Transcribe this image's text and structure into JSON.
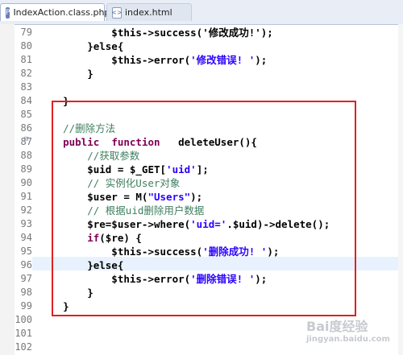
{
  "tabs": [
    {
      "label": "IndexAction.class.php",
      "active": true,
      "close": "☒"
    },
    {
      "label": "index.html",
      "active": false
    }
  ],
  "code_lines": [
    {
      "n": "79",
      "segments": [
        {
          "t": "            $this->success('修改成功!');",
          "c": ""
        }
      ]
    },
    {
      "n": "80",
      "segments": [
        {
          "t": "        }else{",
          "c": ""
        }
      ]
    },
    {
      "n": "81",
      "segments": [
        {
          "t": "            $this->error(",
          "c": ""
        },
        {
          "t": "'修改错误! '",
          "c": "st"
        },
        {
          "t": ");",
          "c": ""
        }
      ]
    },
    {
      "n": "82",
      "segments": [
        {
          "t": "        }",
          "c": ""
        }
      ]
    },
    {
      "n": "83",
      "segments": [
        {
          "t": "",
          "c": ""
        }
      ]
    },
    {
      "n": "84",
      "segments": [
        {
          "t": "    }",
          "c": ""
        }
      ]
    },
    {
      "n": "85",
      "segments": [
        {
          "t": "",
          "c": ""
        }
      ]
    },
    {
      "n": "86",
      "segments": [
        {
          "t": "    ",
          "c": ""
        },
        {
          "t": "//删除方法",
          "c": "cm"
        }
      ]
    },
    {
      "n": "87",
      "segments": [
        {
          "t": "    ",
          "c": ""
        },
        {
          "t": "public",
          "c": "kw"
        },
        {
          "t": "  ",
          "c": ""
        },
        {
          "t": "function",
          "c": "kw"
        },
        {
          "t": "   deleteUser(){",
          "c": ""
        }
      ]
    },
    {
      "n": "88",
      "segments": [
        {
          "t": "        ",
          "c": ""
        },
        {
          "t": "//获取参数",
          "c": "cm"
        }
      ]
    },
    {
      "n": "89",
      "segments": [
        {
          "t": "        $uid = $_GET[",
          "c": ""
        },
        {
          "t": "'uid'",
          "c": "st"
        },
        {
          "t": "];",
          "c": ""
        }
      ]
    },
    {
      "n": "90",
      "segments": [
        {
          "t": "        ",
          "c": ""
        },
        {
          "t": "// 实例化User对象",
          "c": "cm"
        }
      ]
    },
    {
      "n": "91",
      "segments": [
        {
          "t": "        $user = M(",
          "c": ""
        },
        {
          "t": "\"Users\"",
          "c": "st"
        },
        {
          "t": ");",
          "c": ""
        }
      ]
    },
    {
      "n": "92",
      "segments": [
        {
          "t": "        ",
          "c": ""
        },
        {
          "t": "// 根据uid删除用户数据",
          "c": "cm"
        }
      ]
    },
    {
      "n": "93",
      "segments": [
        {
          "t": "        $re=$user->where(",
          "c": ""
        },
        {
          "t": "'uid='",
          "c": "st"
        },
        {
          "t": ".$uid)->delete();",
          "c": ""
        }
      ]
    },
    {
      "n": "94",
      "segments": [
        {
          "t": "        ",
          "c": ""
        },
        {
          "t": "if",
          "c": "kw"
        },
        {
          "t": "($re) {",
          "c": ""
        }
      ]
    },
    {
      "n": "95",
      "segments": [
        {
          "t": "            $this->success(",
          "c": ""
        },
        {
          "t": "'删除成功! '",
          "c": "st"
        },
        {
          "t": ");",
          "c": ""
        }
      ]
    },
    {
      "n": "96",
      "segments": [
        {
          "t": "        }else{",
          "c": ""
        }
      ]
    },
    {
      "n": "97",
      "segments": [
        {
          "t": "            $this->error(",
          "c": ""
        },
        {
          "t": "'删除错误! '",
          "c": "st"
        },
        {
          "t": ");",
          "c": ""
        }
      ]
    },
    {
      "n": "98",
      "segments": [
        {
          "t": "        }",
          "c": ""
        }
      ]
    },
    {
      "n": "99",
      "segments": [
        {
          "t": "    }",
          "c": ""
        }
      ]
    },
    {
      "n": "100",
      "segments": [
        {
          "t": "",
          "c": ""
        }
      ]
    },
    {
      "n": "101",
      "segments": [
        {
          "t": "",
          "c": ""
        }
      ]
    },
    {
      "n": "102",
      "segments": [
        {
          "t": "",
          "c": ""
        }
      ]
    }
  ],
  "watermark": {
    "main": "Bai度经验",
    "sub": "jingyan.baidu.com"
  }
}
